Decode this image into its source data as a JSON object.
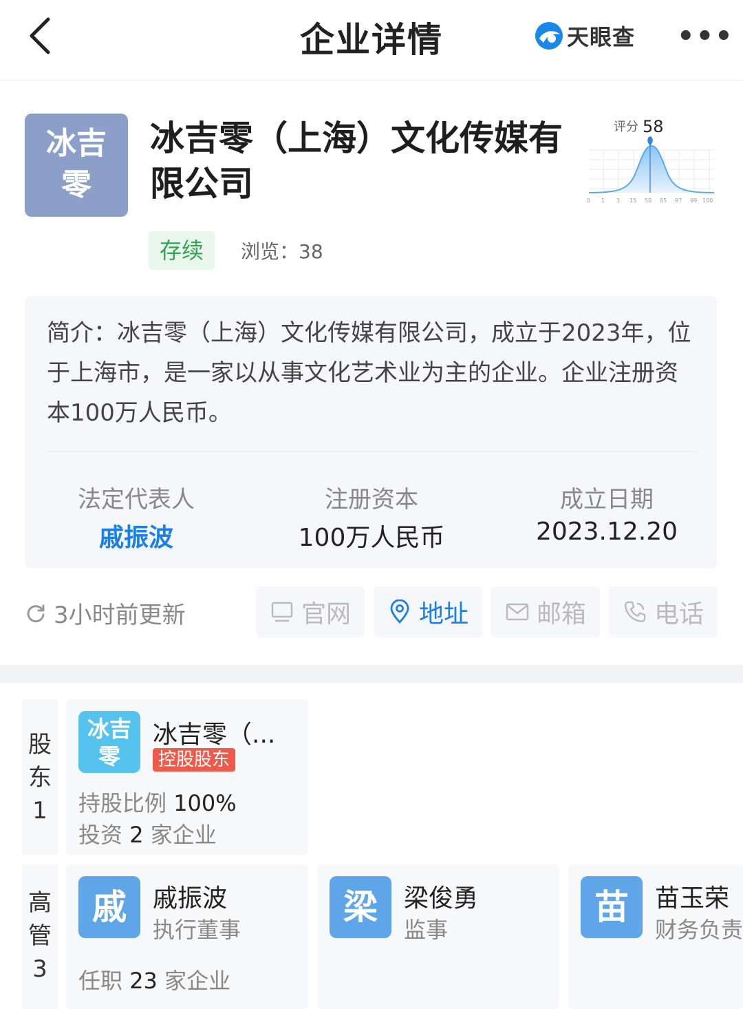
{
  "header": {
    "title": "企业详情",
    "brand": "天眼查",
    "more": "•••"
  },
  "company": {
    "logo_lines": [
      "冰吉",
      "零"
    ],
    "name": "冰吉零（上海）文化传媒有限公司",
    "status": "存续",
    "views": "浏览：38",
    "score_label": "评分",
    "score": "58",
    "score_axis": [
      "0",
      "1",
      "3",
      "15",
      "50",
      "85",
      "97",
      "99",
      "100"
    ]
  },
  "intro": {
    "text": "简介：冰吉零（上海）文化传媒有限公司，成立于2023年，位于上海市，是一家以从事文化艺术业为主的企业。企业注册资本100万人民币。"
  },
  "stats": [
    {
      "label": "法定代表人",
      "value": "戚振波"
    },
    {
      "label": "注册资本",
      "value": "100万人民币"
    },
    {
      "label": "成立日期",
      "value": "2023.12.20"
    }
  ],
  "update": {
    "text": "3小时前更新"
  },
  "actions": [
    {
      "label": "官网",
      "icon": "monitor-icon",
      "active": false
    },
    {
      "label": "地址",
      "icon": "location-pin-icon",
      "active": true
    },
    {
      "label": "邮箱",
      "icon": "mail-icon",
      "active": false
    },
    {
      "label": "电话",
      "icon": "phone-icon",
      "active": false
    }
  ],
  "shareholders": {
    "side_label": [
      "股",
      "东",
      "1"
    ],
    "items": [
      {
        "avatar_lines": [
          "冰吉",
          "零"
        ],
        "name": "冰吉零（...",
        "badge": "控股股东",
        "ratio_label": "持股比例",
        "ratio": "100%",
        "invest_prefix": "投资",
        "invest_count": "2",
        "invest_suffix": "家企业"
      }
    ]
  },
  "executives": {
    "side_label": [
      "高",
      "管",
      "3"
    ],
    "items": [
      {
        "avatar": "戚",
        "name": "戚振波",
        "role": "执行董事",
        "post_prefix": "任职",
        "post_count": "23",
        "post_suffix": "家企业"
      },
      {
        "avatar": "梁",
        "name": "梁俊勇",
        "role": "监事"
      },
      {
        "avatar": "苗",
        "name": "苗玉荣",
        "role": "财务负责"
      }
    ]
  },
  "colors": {
    "accent": "#1a7fe6",
    "logo_bg": "#8c9fc8",
    "status_green": "#36a353",
    "badge_red": "#f05a4a",
    "avatar_blue": "#5ea6e8",
    "avatar_cyan": "#56c3ee"
  }
}
